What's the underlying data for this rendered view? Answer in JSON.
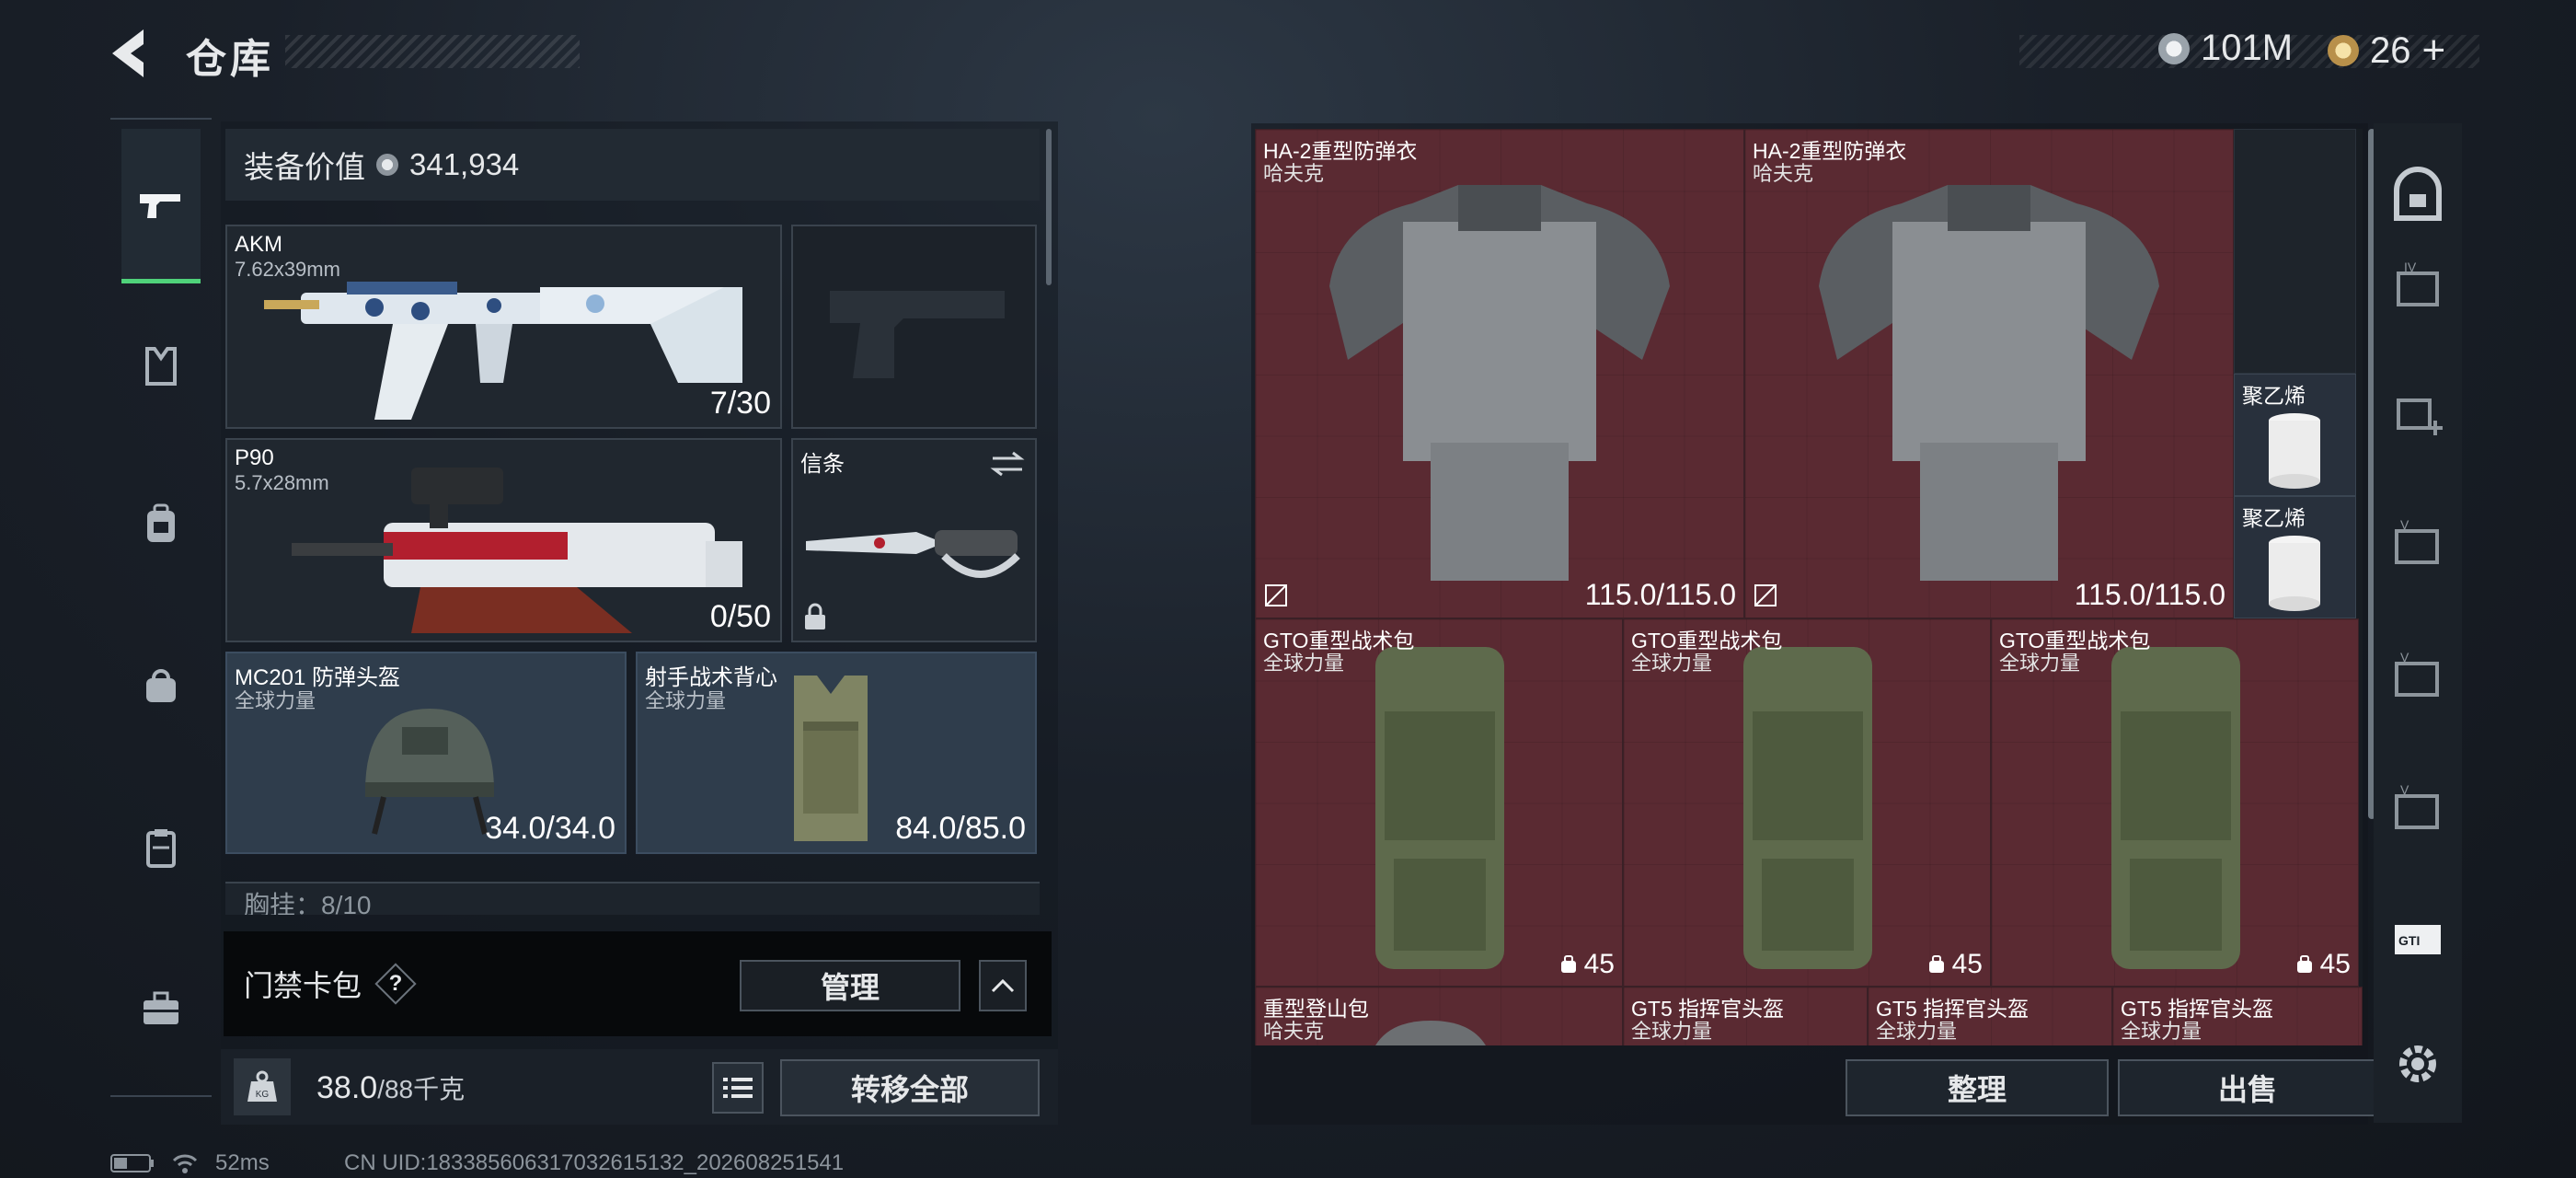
{
  "header": {
    "title": "仓库",
    "currency_silver": "101M",
    "currency_gold": "26",
    "add_symbol": "+"
  },
  "equipment": {
    "value_label": "装备价值",
    "value": "341,934",
    "slots": [
      {
        "name": "AKM",
        "sub": "7.62x39mm",
        "value": "7/30"
      },
      {
        "name": "P90",
        "sub": "5.7x28mm",
        "value": "0/50"
      },
      {
        "name": "信条",
        "sub": "",
        "value": ""
      },
      {
        "name": "MC201 防弹头盔",
        "sub": "全球力量",
        "value": "34.0/34.0"
      },
      {
        "name": "射手战术背心",
        "sub": "全球力量",
        "value": "84.0/85.0"
      }
    ],
    "partial_row": "胸挂：8/10"
  },
  "keycard": {
    "label": "门禁卡包",
    "help": "?",
    "manage": "管理"
  },
  "weight": {
    "icon_text": "KG",
    "current": "38.0",
    "capacity": "/88千克",
    "transfer_all": "转移全部"
  },
  "status_bar": {
    "ping": "52ms",
    "uid": "CN UID:18338560631703261513​2_202608251541"
  },
  "storage": {
    "items": [
      {
        "name": "HA-2重型防弹衣",
        "sub": "哈夫克",
        "value": "115.0/115.0"
      },
      {
        "name": "HA-2重型防弹衣",
        "sub": "哈夫克",
        "value": "115.0/115.0"
      },
      {
        "name": "聚乙烯",
        "sub": "",
        "value": ""
      },
      {
        "name": "聚乙烯",
        "sub": "",
        "value": ""
      },
      {
        "name": "GTO重型战术包",
        "sub": "全球力量",
        "value": "45"
      },
      {
        "name": "GTO重型战术包",
        "sub": "全球力量",
        "value": "45"
      },
      {
        "name": "GTO重型战术包",
        "sub": "全球力量",
        "value": "45"
      },
      {
        "name": "重型登山包",
        "sub": "哈夫克",
        "value": ""
      },
      {
        "name": "GT5 指挥官头盔",
        "sub": "全球力量",
        "value": ""
      },
      {
        "name": "GT5 指挥官头盔",
        "sub": "全球力量",
        "value": ""
      },
      {
        "name": "GT5 指挥官头盔",
        "sub": "全球力量",
        "value": ""
      }
    ],
    "sort": "整理",
    "sell": "出售"
  },
  "left_rail": [
    "pistol-icon",
    "vest-icon",
    "backpack-icon",
    "pouch-icon",
    "container-icon",
    "toolbox-icon"
  ],
  "right_rail": [
    "safe-icon",
    "storage-iv-icon",
    "storage-iv-add-icon",
    "storage-v-icon",
    "storage-v2-icon",
    "storage-v3-icon",
    "gti-icon",
    "settings-icon"
  ],
  "colors": {
    "accent_green": "#4fd27a",
    "cell_red": "#5a2a32",
    "cell_blue": "#2f3d4c",
    "panel": "#20272f"
  }
}
